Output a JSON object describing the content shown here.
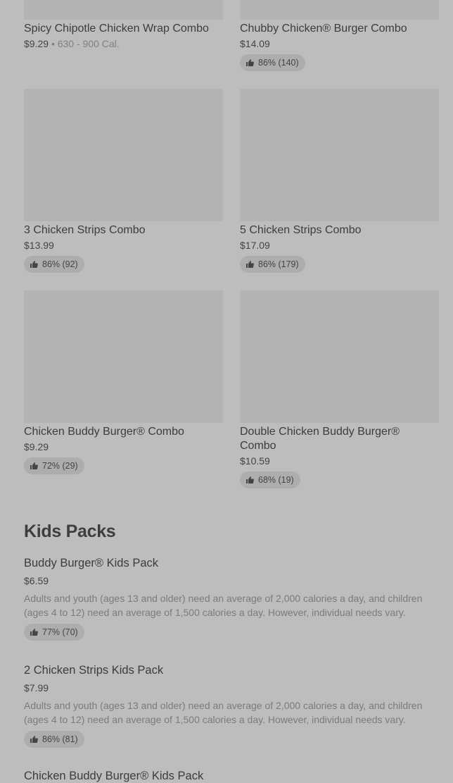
{
  "grid_items": [
    {
      "name": "Spicy Chipotle Chicken Wrap Combo",
      "price": "$9.29",
      "calories": "630 - 900 Cal."
    },
    {
      "name": "Chubby Chicken® Burger Combo",
      "price": "$14.09",
      "rating": "86% (140)"
    },
    {
      "name": "3 Chicken Strips Combo",
      "price": "$13.99",
      "rating": "86% (92)"
    },
    {
      "name": "5 Chicken Strips Combo",
      "price": "$17.09",
      "rating": "86% (179)"
    },
    {
      "name": "Chicken Buddy Burger® Combo",
      "price": "$9.29",
      "rating": "72% (29)"
    },
    {
      "name": "Double Chicken Buddy Burger® Combo",
      "price": "$10.59",
      "rating": "68% (19)"
    }
  ],
  "kids_section": {
    "title": "Kids Packs",
    "items": [
      {
        "name": "Buddy Burger® Kids Pack",
        "price": "$6.59",
        "description": "Adults and youth (ages 13 and older) need an average of 2,000 calories a day, and children (ages 4 to 12) need an average of 1,500 calories a day. However, individual needs vary.",
        "rating": "77% (70)"
      },
      {
        "name": "2 Chicken Strips Kids Pack",
        "price": "$7.99",
        "description": "Adults and youth (ages 13 and older) need an average of 2,000 calories a day, and children (ages 4 to 12) need an average of 1,500 calories a day. However, individual needs vary.",
        "rating": "86% (81)"
      },
      {
        "name": "Chicken Buddy Burger® Kids Pack"
      }
    ]
  },
  "icons": {
    "rating": "thumbs-up-icon"
  }
}
